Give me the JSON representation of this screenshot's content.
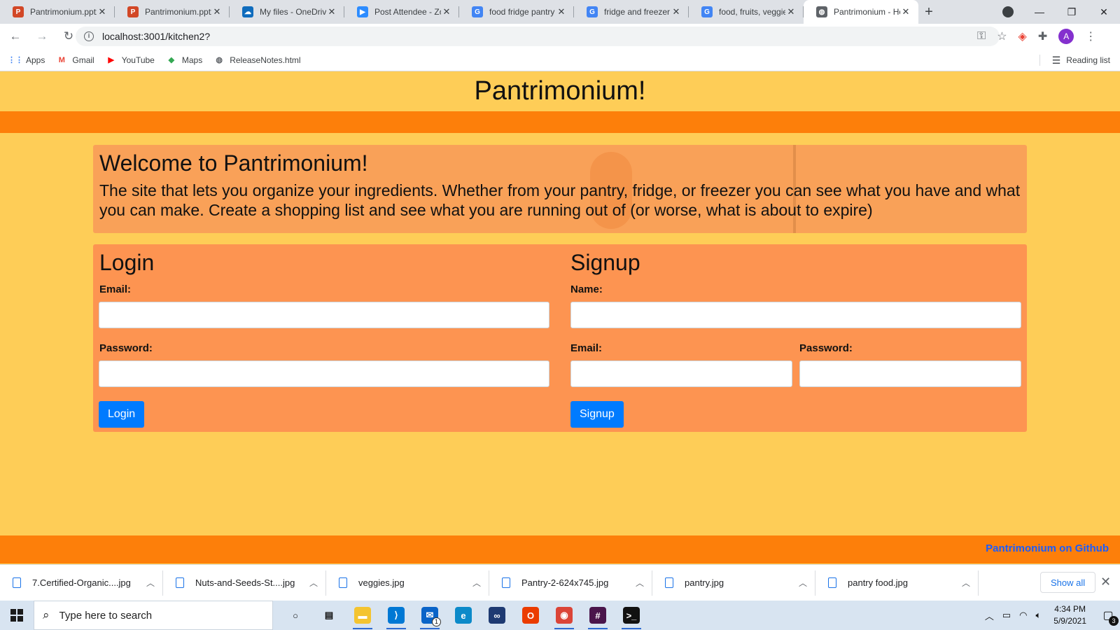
{
  "browser": {
    "tabs": [
      {
        "label": "Pantrimonium.pptx",
        "icon": "powerpoint-icon",
        "color": "#d24726",
        "glyph": "P"
      },
      {
        "label": "Pantrimonium.pptx",
        "icon": "powerpoint-icon",
        "color": "#d24726",
        "glyph": "P"
      },
      {
        "label": "My files - OneDrive",
        "icon": "onedrive-icon",
        "color": "#0f6cbd",
        "glyph": "☁"
      },
      {
        "label": "Post Attendee - Zoom",
        "icon": "zoom-icon",
        "color": "#2d8cff",
        "glyph": "▶"
      },
      {
        "label": "food fridge pantry",
        "icon": "google-icon",
        "color": "#4285f4",
        "glyph": "G"
      },
      {
        "label": "fridge and freezer s",
        "icon": "google-icon",
        "color": "#4285f4",
        "glyph": "G"
      },
      {
        "label": "food, fruits, veggie",
        "icon": "google-icon",
        "color": "#4285f4",
        "glyph": "G"
      },
      {
        "label": "Pantrimonium - Ho",
        "icon": "globe-icon",
        "color": "#5f6368",
        "glyph": "◍"
      }
    ],
    "new_tab": "+",
    "url": "localhost:3001/kitchen2?",
    "bookmarks": [
      {
        "label": "Apps",
        "icon": "apps-grid-icon",
        "color": "#4285f4",
        "glyph": "⋮⋮"
      },
      {
        "label": "Gmail",
        "icon": "gmail-icon",
        "color": "#ea4335",
        "glyph": "M"
      },
      {
        "label": "YouTube",
        "icon": "youtube-icon",
        "color": "#ff0000",
        "glyph": "▶"
      },
      {
        "label": "Maps",
        "icon": "maps-icon",
        "color": "#34a853",
        "glyph": "◆"
      },
      {
        "label": "ReleaseNotes.html",
        "icon": "globe-icon",
        "color": "#5f6368",
        "glyph": "◍"
      }
    ],
    "reading_list": "Reading list",
    "profile_initial": "A"
  },
  "page": {
    "site_title": "Pantrimonium!",
    "welcome": {
      "heading": "Welcome to Pantrimonium!",
      "body": "The site that lets you organize your ingredients. Whether from your pantry, fridge, or freezer you can see what you have and what you can make. Create a shopping list and see what you are running out of (or worse, what is about to expire)"
    },
    "login": {
      "heading": "Login",
      "email_label": "Email:",
      "password_label": "Password:",
      "button": "Login"
    },
    "signup": {
      "heading": "Signup",
      "name_label": "Name:",
      "email_label": "Email:",
      "password_label": "Password:",
      "button": "Signup"
    },
    "footer_link": "Pantrimonium on Github",
    "colors": {
      "background": "#fecd57",
      "bar": "#fd7f0a",
      "panel": "#fd9451",
      "button": "#007bff"
    }
  },
  "downloads": {
    "files": [
      "7.Certified-Organic....jpg",
      "Nuts-and-Seeds-St....jpg",
      "veggies.jpg",
      "Pantry-2-624x745.jpg",
      "pantry.jpg",
      "pantry food.jpg"
    ],
    "show_all": "Show all"
  },
  "taskbar": {
    "search_placeholder": "Type here to search",
    "time": "4:34 PM",
    "date": "5/9/2021",
    "notification_count": "3",
    "mail_badge": "1",
    "apps": [
      {
        "name": "cortana-icon",
        "color": "#d8e4f1",
        "glyph": "○",
        "fg": "#111",
        "running": false
      },
      {
        "name": "task-view-icon",
        "color": "#d8e4f1",
        "glyph": "▤",
        "fg": "#111",
        "running": false
      },
      {
        "name": "file-explorer-icon",
        "color": "#f4c430",
        "glyph": "▬",
        "fg": "#fff",
        "running": true
      },
      {
        "name": "vscode-icon",
        "color": "#0078d4",
        "glyph": "⟩",
        "fg": "#fff",
        "running": true
      },
      {
        "name": "mail-icon",
        "color": "#0a64c8",
        "glyph": "✉",
        "fg": "#fff",
        "running": true
      },
      {
        "name": "edge-icon",
        "color": "#0c8ac9",
        "glyph": "e",
        "fg": "#fff",
        "running": false
      },
      {
        "name": "visual-studio-icon",
        "color": "#1e3a72",
        "glyph": "∞",
        "fg": "#fff",
        "running": false
      },
      {
        "name": "office-icon",
        "color": "#eb3c00",
        "glyph": "O",
        "fg": "#fff",
        "running": false
      },
      {
        "name": "chrome-icon",
        "color": "#db4437",
        "glyph": "◉",
        "fg": "#fff",
        "running": true
      },
      {
        "name": "slack-icon",
        "color": "#4a154b",
        "glyph": "#",
        "fg": "#fff",
        "running": true
      },
      {
        "name": "terminal-icon",
        "color": "#111111",
        "glyph": ">_",
        "fg": "#fff",
        "running": true
      }
    ]
  }
}
